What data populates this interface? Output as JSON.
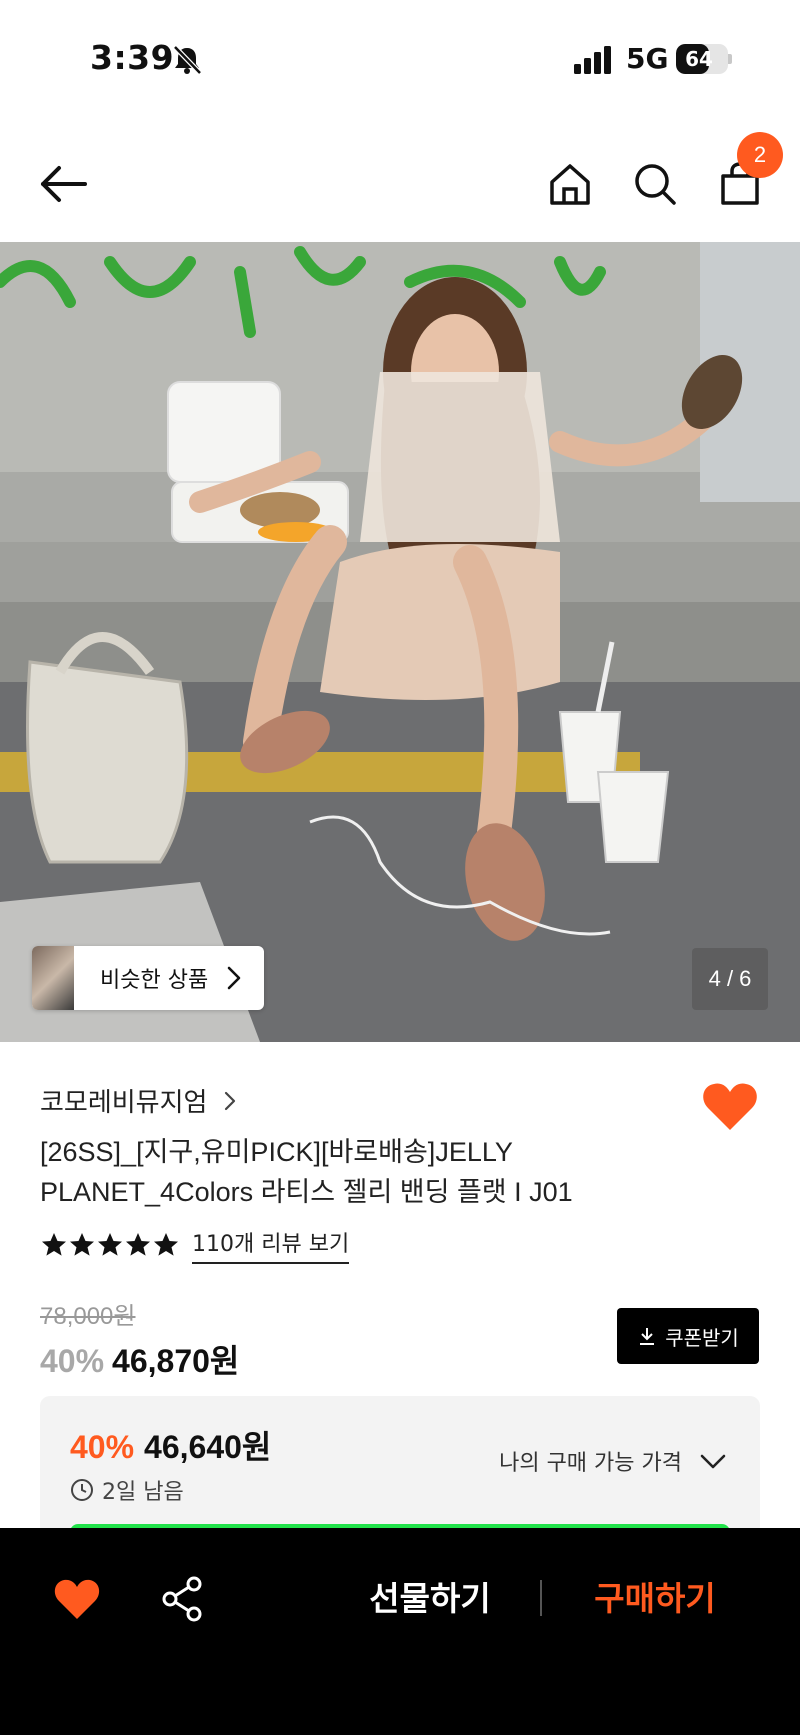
{
  "status_bar": {
    "time": "3:39",
    "network": "5G",
    "battery_level": "64",
    "battery_fraction": 0.64,
    "icons": [
      "bell-muted-icon",
      "signal-icon"
    ]
  },
  "nav": {
    "cart_count": "2",
    "icons": [
      "back-arrow-icon",
      "home-icon",
      "search-icon",
      "shopping-bag-icon"
    ]
  },
  "hero": {
    "similar_products_label": "비슷한 상품",
    "page_counter": "4 / 6",
    "current_page": 4,
    "total_pages": 6
  },
  "product": {
    "brand": "코모레비뮤지엄",
    "title": "[26SS]_[지구,유미PICK][바로배송]JELLY PLANET_4Colors 라티스 젤리 밴딩 플랫 I J01",
    "rating_stars": 5,
    "review_link": "110개 리뷰 보기",
    "original_price": "78,000원",
    "discount_pct": "40%",
    "sale_price": "46,870원",
    "coupon_label": "쿠폰받기"
  },
  "my_price": {
    "discount_pct": "40%",
    "price": "46,640원",
    "time_left": "2일 남음",
    "toggle_label": "나의 구매 가능 가격"
  },
  "bottom_bar": {
    "gift_label": "선물하기",
    "buy_label": "구매하기"
  },
  "colors": {
    "accent": "#ff5a1f",
    "green": "#21e24a",
    "black": "#000000"
  }
}
